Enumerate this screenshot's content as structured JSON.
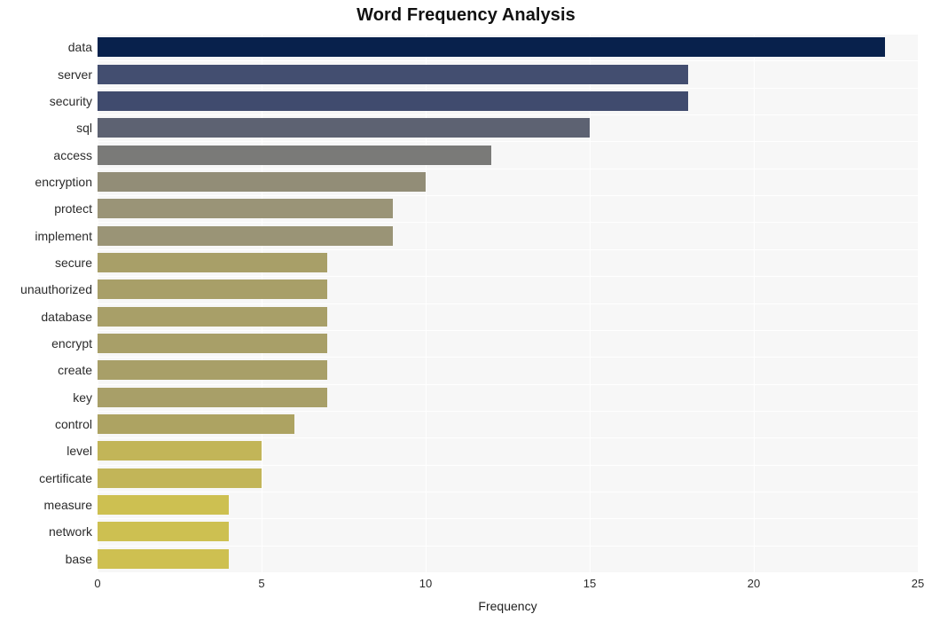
{
  "chart_data": {
    "type": "bar",
    "orientation": "horizontal",
    "title": "Word Frequency Analysis",
    "xlabel": "Frequency",
    "ylabel": "",
    "xlim": [
      0,
      25
    ],
    "xticks": [
      0,
      5,
      10,
      15,
      20,
      25
    ],
    "grid": true,
    "legend": null,
    "categories": [
      "data",
      "server",
      "security",
      "sql",
      "access",
      "encryption",
      "protect",
      "implement",
      "secure",
      "unauthorized",
      "database",
      "encrypt",
      "create",
      "key",
      "control",
      "level",
      "certificate",
      "measure",
      "network",
      "base"
    ],
    "values": [
      24,
      18,
      18,
      15,
      12,
      10,
      9,
      9,
      7,
      7,
      7,
      7,
      7,
      7,
      6,
      5,
      5,
      4,
      4,
      4
    ],
    "bar_colors": [
      "#08214c",
      "#434e70",
      "#404b6e",
      "#5d6272",
      "#7a7a78",
      "#928d77",
      "#9a9477",
      "#9a9476",
      "#a89f68",
      "#a89f68",
      "#a89f68",
      "#a89f68",
      "#a89f68",
      "#a89f68",
      "#ada362",
      "#c2b558",
      "#c2b558",
      "#cdc051",
      "#cdc051",
      "#cec051"
    ],
    "plot_background": "#f7f7f7",
    "gridline_color": "#ffffff",
    "figure_background": "#ffffff"
  }
}
